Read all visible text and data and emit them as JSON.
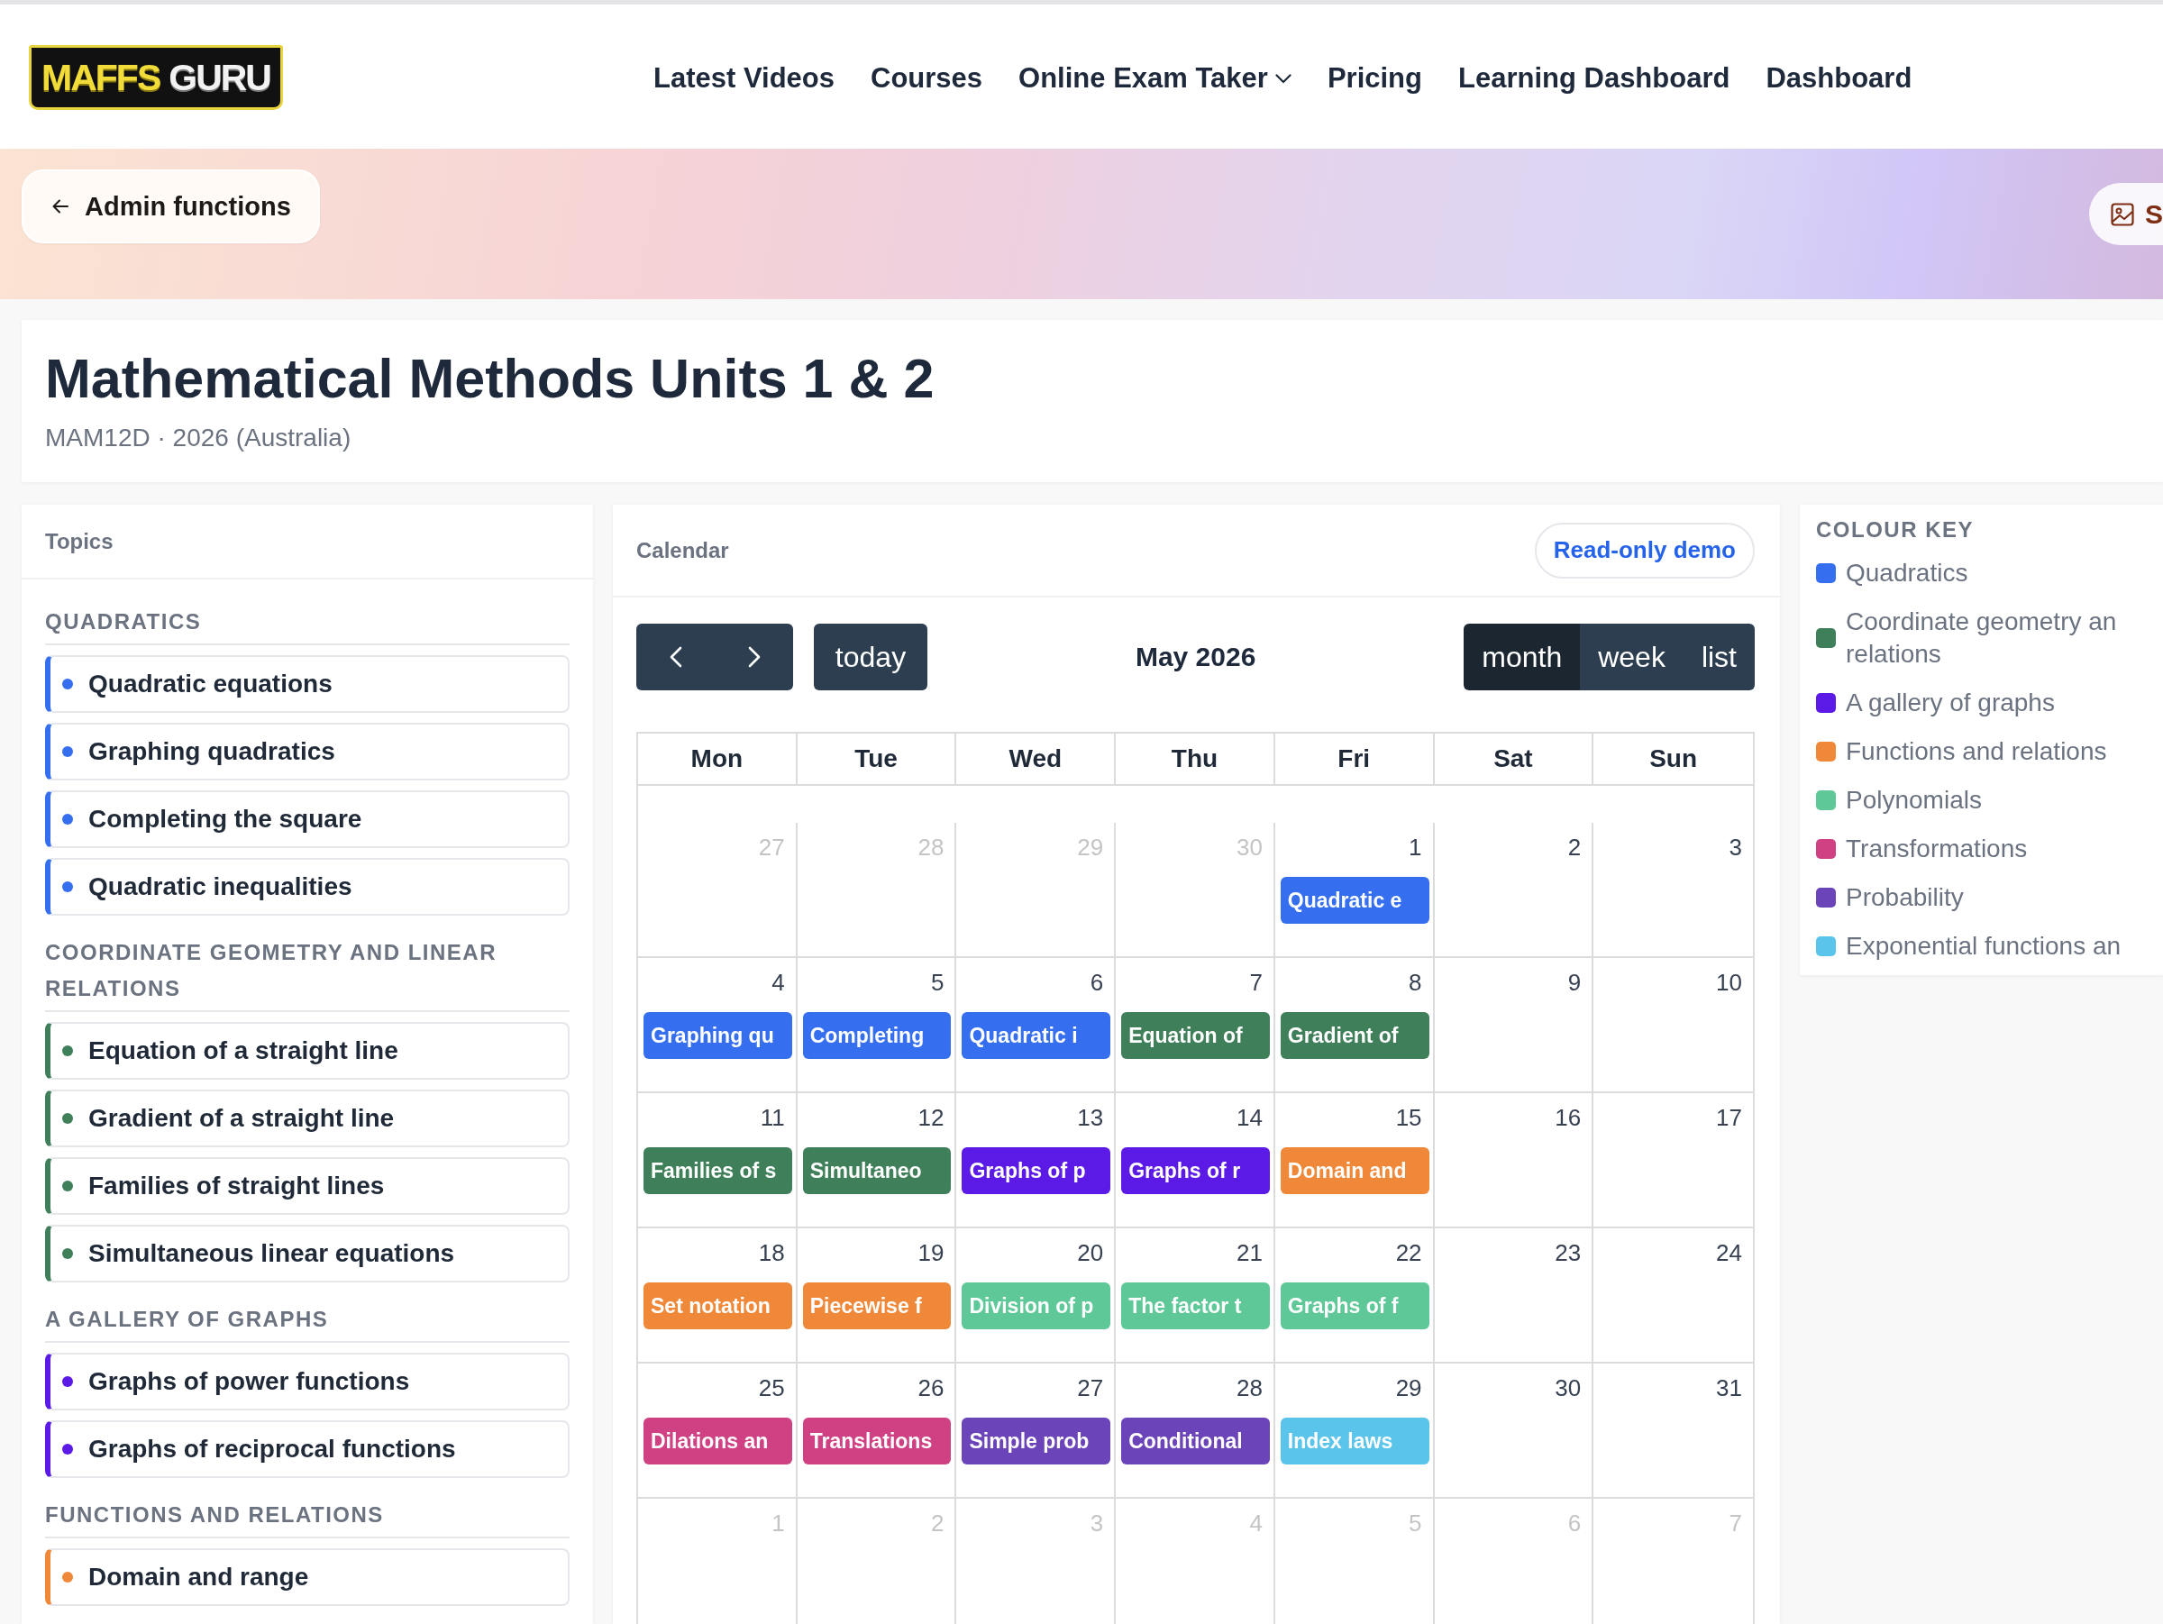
{
  "header": {
    "logo": {
      "first_word": "MAFFS",
      "second_word": "GURU"
    },
    "nav": [
      {
        "label": "Latest Videos",
        "has_menu": false
      },
      {
        "label": "Courses",
        "has_menu": false
      },
      {
        "label": "Online Exam Taker",
        "has_menu": true
      },
      {
        "label": "Pricing",
        "has_menu": false
      },
      {
        "label": "Learning Dashboard",
        "has_menu": false
      },
      {
        "label": "Dashboard",
        "has_menu": false
      }
    ]
  },
  "banner": {
    "back_button": "Admin functions",
    "side_button": "S"
  },
  "course": {
    "title": "Mathematical Methods Units 1 & 2",
    "subtitle": "MAM12D · 2026 (Australia)"
  },
  "topics": {
    "title": "Topics",
    "groups": [
      {
        "heading": "QUADRATICS",
        "color": "#356ff0",
        "items": [
          "Quadratic equations",
          "Graphing quadratics",
          "Completing the square",
          "Quadratic inequalities"
        ]
      },
      {
        "heading": "COORDINATE GEOMETRY AND LINEAR RELATIONS",
        "color": "#3f7f5a",
        "items": [
          "Equation of a straight line",
          "Gradient of a straight line",
          "Families of straight lines",
          "Simultaneous linear equations"
        ]
      },
      {
        "heading": "A GALLERY OF GRAPHS",
        "color": "#5b1ae6",
        "items": [
          "Graphs of power functions",
          "Graphs of reciprocal functions"
        ]
      },
      {
        "heading": "FUNCTIONS AND RELATIONS",
        "color": "#f0883a",
        "items": [
          "Domain and range"
        ]
      }
    ]
  },
  "calendar": {
    "title": "Calendar",
    "badge": "Read-only demo",
    "today_button": "today",
    "period": "May 2026",
    "views": [
      {
        "label": "month",
        "selected": true
      },
      {
        "label": "week",
        "selected": false
      },
      {
        "label": "list",
        "selected": false
      }
    ],
    "weekdays": [
      "Mon",
      "Tue",
      "Wed",
      "Thu",
      "Fri",
      "Sat",
      "Sun"
    ],
    "weeks": [
      {
        "days": [
          {
            "day": "27",
            "other_month": true
          },
          {
            "day": "28",
            "other_month": true
          },
          {
            "day": "29",
            "other_month": true
          },
          {
            "day": "30",
            "other_month": true
          },
          {
            "day": "1",
            "other_month": false,
            "events": [
              {
                "title": "Quadratic e",
                "color": "#356ff0"
              }
            ]
          },
          {
            "day": "2",
            "other_month": false
          },
          {
            "day": "3",
            "other_month": false
          }
        ]
      },
      {
        "days": [
          {
            "day": "4",
            "other_month": false,
            "events": [
              {
                "title": "Graphing qu",
                "color": "#356ff0"
              }
            ]
          },
          {
            "day": "5",
            "other_month": false,
            "events": [
              {
                "title": "Completing",
                "color": "#356ff0"
              }
            ]
          },
          {
            "day": "6",
            "other_month": false,
            "events": [
              {
                "title": "Quadratic i",
                "color": "#356ff0"
              }
            ]
          },
          {
            "day": "7",
            "other_month": false,
            "events": [
              {
                "title": "Equation of",
                "color": "#3f7f5a"
              }
            ]
          },
          {
            "day": "8",
            "other_month": false,
            "events": [
              {
                "title": "Gradient of",
                "color": "#3f7f5a"
              }
            ]
          },
          {
            "day": "9",
            "other_month": false
          },
          {
            "day": "10",
            "other_month": false
          }
        ]
      },
      {
        "days": [
          {
            "day": "11",
            "other_month": false,
            "events": [
              {
                "title": "Families of s",
                "color": "#3f7f5a"
              }
            ]
          },
          {
            "day": "12",
            "other_month": false,
            "events": [
              {
                "title": "Simultaneo",
                "color": "#3f7f5a"
              }
            ]
          },
          {
            "day": "13",
            "other_month": false,
            "events": [
              {
                "title": "Graphs of p",
                "color": "#5b1ae6"
              }
            ]
          },
          {
            "day": "14",
            "other_month": false,
            "events": [
              {
                "title": "Graphs of r",
                "color": "#5b1ae6"
              }
            ]
          },
          {
            "day": "15",
            "other_month": false,
            "events": [
              {
                "title": "Domain and",
                "color": "#f0883a"
              }
            ]
          },
          {
            "day": "16",
            "other_month": false
          },
          {
            "day": "17",
            "other_month": false
          }
        ]
      },
      {
        "days": [
          {
            "day": "18",
            "other_month": false,
            "events": [
              {
                "title": "Set notation",
                "color": "#f0883a"
              }
            ]
          },
          {
            "day": "19",
            "other_month": false,
            "events": [
              {
                "title": "Piecewise f",
                "color": "#f0883a"
              }
            ]
          },
          {
            "day": "20",
            "other_month": false,
            "events": [
              {
                "title": "Division of p",
                "color": "#5ec898"
              }
            ]
          },
          {
            "day": "21",
            "other_month": false,
            "events": [
              {
                "title": "The factor t",
                "color": "#5ec898"
              }
            ]
          },
          {
            "day": "22",
            "other_month": false,
            "events": [
              {
                "title": "Graphs of f",
                "color": "#5ec898"
              }
            ]
          },
          {
            "day": "23",
            "other_month": false
          },
          {
            "day": "24",
            "other_month": false
          }
        ]
      },
      {
        "days": [
          {
            "day": "25",
            "other_month": false,
            "events": [
              {
                "title": "Dilations an",
                "color": "#cf4182"
              }
            ]
          },
          {
            "day": "26",
            "other_month": false,
            "events": [
              {
                "title": "Translations",
                "color": "#cf4182"
              }
            ]
          },
          {
            "day": "27",
            "other_month": false,
            "events": [
              {
                "title": "Simple prob",
                "color": "#6a44b8"
              }
            ]
          },
          {
            "day": "28",
            "other_month": false,
            "events": [
              {
                "title": "Conditional",
                "color": "#6a44b8"
              }
            ]
          },
          {
            "day": "29",
            "other_month": false,
            "events": [
              {
                "title": "Index laws",
                "color": "#5bc4ea"
              }
            ]
          },
          {
            "day": "30",
            "other_month": false
          },
          {
            "day": "31",
            "other_month": false
          }
        ]
      },
      {
        "days": [
          {
            "day": "1",
            "other_month": true
          },
          {
            "day": "2",
            "other_month": true
          },
          {
            "day": "3",
            "other_month": true
          },
          {
            "day": "4",
            "other_month": true
          },
          {
            "day": "5",
            "other_month": true
          },
          {
            "day": "6",
            "other_month": true
          },
          {
            "day": "7",
            "other_month": true
          }
        ]
      }
    ]
  },
  "colour_key": {
    "title": "COLOUR KEY",
    "items": [
      {
        "label": "Quadratics",
        "color": "#356ff0"
      },
      {
        "label": "Coordinate geometry an relations",
        "color": "#3f7f5a"
      },
      {
        "label": "A gallery of graphs",
        "color": "#5b1ae6"
      },
      {
        "label": "Functions and relations",
        "color": "#f0883a"
      },
      {
        "label": "Polynomials",
        "color": "#5ec898"
      },
      {
        "label": "Transformations",
        "color": "#cf4182"
      },
      {
        "label": "Probability",
        "color": "#6a44b8"
      },
      {
        "label": "Exponential functions an",
        "color": "#5bc4ea"
      }
    ]
  }
}
